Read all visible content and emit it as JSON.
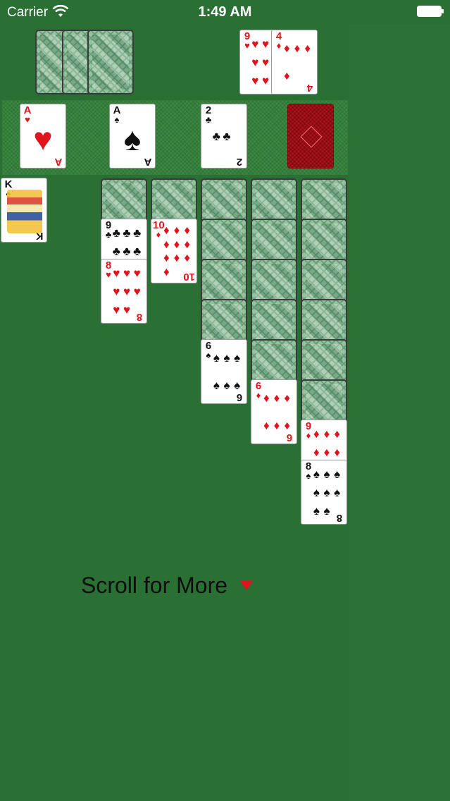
{
  "status_bar": {
    "carrier": "Carrier",
    "time": "1:49 AM"
  },
  "game": {
    "stock": {
      "card_count_visible": 3
    },
    "waste": [
      {
        "rank": "9",
        "suit": "♥",
        "color": "red"
      },
      {
        "rank": "4",
        "suit": "♦",
        "color": "red"
      }
    ],
    "foundations": [
      {
        "rank": "A",
        "suit": "♥",
        "color": "red"
      },
      {
        "rank": "A",
        "suit": "♠",
        "color": "black"
      },
      {
        "rank": "2",
        "suit": "♣",
        "color": "black"
      },
      {
        "face_down": true
      }
    ],
    "free_card": {
      "rank": "K",
      "suit": "♠",
      "color": "black"
    },
    "tableau": [
      {
        "face_down": 1,
        "up": [
          {
            "rank": "9",
            "suit": "♣",
            "color": "black"
          },
          {
            "rank": "8",
            "suit": "♥",
            "color": "red"
          }
        ]
      },
      {
        "face_down": 1,
        "up": [
          {
            "rank": "10",
            "suit": "♦",
            "color": "red"
          }
        ]
      },
      {
        "face_down": 4,
        "up": [
          {
            "rank": "6",
            "suit": "♠",
            "color": "black"
          }
        ]
      },
      {
        "face_down": 5,
        "up": [
          {
            "rank": "6",
            "suit": "♦",
            "color": "red"
          }
        ]
      },
      {
        "face_down": 6,
        "up": [
          {
            "rank": "9",
            "suit": "♦",
            "color": "red"
          },
          {
            "rank": "8",
            "suit": "♠",
            "color": "black"
          }
        ]
      }
    ]
  },
  "footer": {
    "scroll_label": "Scroll for More"
  },
  "colors": {
    "table_green": "#2a7034",
    "suit_red": "#e0141c",
    "suit_black": "#111111"
  }
}
